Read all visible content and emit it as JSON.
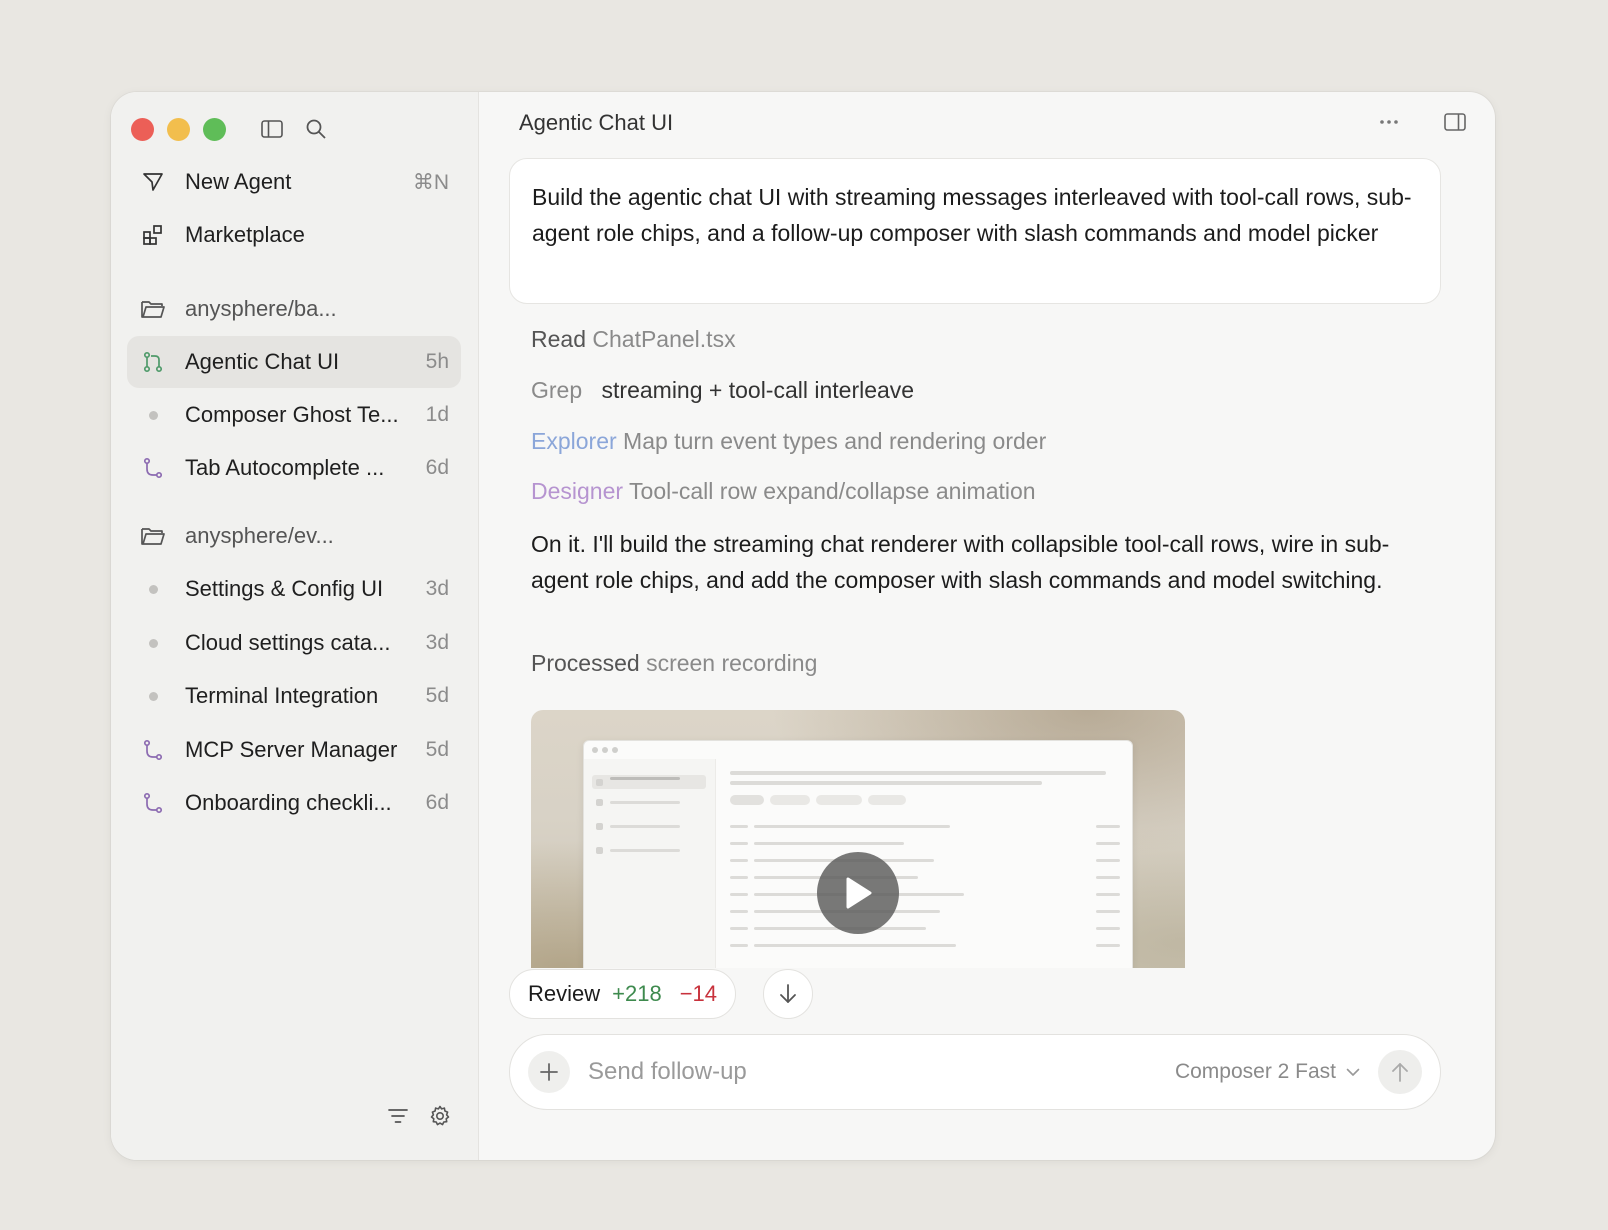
{
  "sidebar": {
    "new_agent": {
      "label": "New Agent",
      "shortcut": "⌘N"
    },
    "marketplace": {
      "label": "Marketplace"
    },
    "groups": [
      {
        "folder": "anysphere/ba...",
        "items": [
          {
            "label": "Agentic Chat UI",
            "time": "5h",
            "icon": "branch-green-icon",
            "active": true
          },
          {
            "label": "Composer Ghost Te...",
            "time": "1d",
            "icon": "dot-icon"
          },
          {
            "label": "Tab Autocomplete ...",
            "time": "6d",
            "icon": "branch-purple-icon"
          }
        ]
      },
      {
        "folder": "anysphere/ev...",
        "items": [
          {
            "label": "Settings & Config UI",
            "time": "3d",
            "icon": "dot-icon"
          },
          {
            "label": "Cloud settings cata...",
            "time": "3d",
            "icon": "dot-icon"
          },
          {
            "label": "Terminal Integration",
            "time": "5d",
            "icon": "dot-icon"
          },
          {
            "label": "MCP Server Manager",
            "time": "5d",
            "icon": "branch-purple-icon"
          },
          {
            "label": "Onboarding checkli...",
            "time": "6d",
            "icon": "branch-purple-icon"
          }
        ]
      }
    ]
  },
  "main": {
    "title": "Agentic Chat UI",
    "prompt": "Build the agentic chat UI with streaming messages interleaved with tool-call rows, sub-agent role chips, and a follow-up composer with slash commands and model picker",
    "steps": [
      {
        "verb": "Read",
        "arg": "ChatPanel.tsx"
      },
      {
        "verb": "Grep",
        "arg": "streaming + tool-call interleave"
      },
      {
        "verb": "Explorer",
        "arg": "Map turn event types and rendering order"
      },
      {
        "verb": "Designer",
        "arg": "Tool-call row expand/collapse animation"
      }
    ],
    "reply": "On it. I'll build the streaming chat renderer with collapsible tool-call rows, wire in sub-agent role chips, and add the composer with slash commands and model switching.",
    "processed": {
      "verb": "Processed",
      "arg": "screen recording"
    },
    "review": {
      "label": "Review",
      "added": "+218",
      "removed": "−14"
    },
    "composer": {
      "placeholder": "Send follow-up",
      "model": "Composer 2 Fast"
    }
  },
  "colors": {
    "accent_green": "#3e8a4e",
    "accent_red": "#c8323c",
    "explorer": "#8ba6d9",
    "designer": "#b694d0",
    "branch_purple": "#8c6bb1",
    "branch_green": "#4f9a6a"
  }
}
